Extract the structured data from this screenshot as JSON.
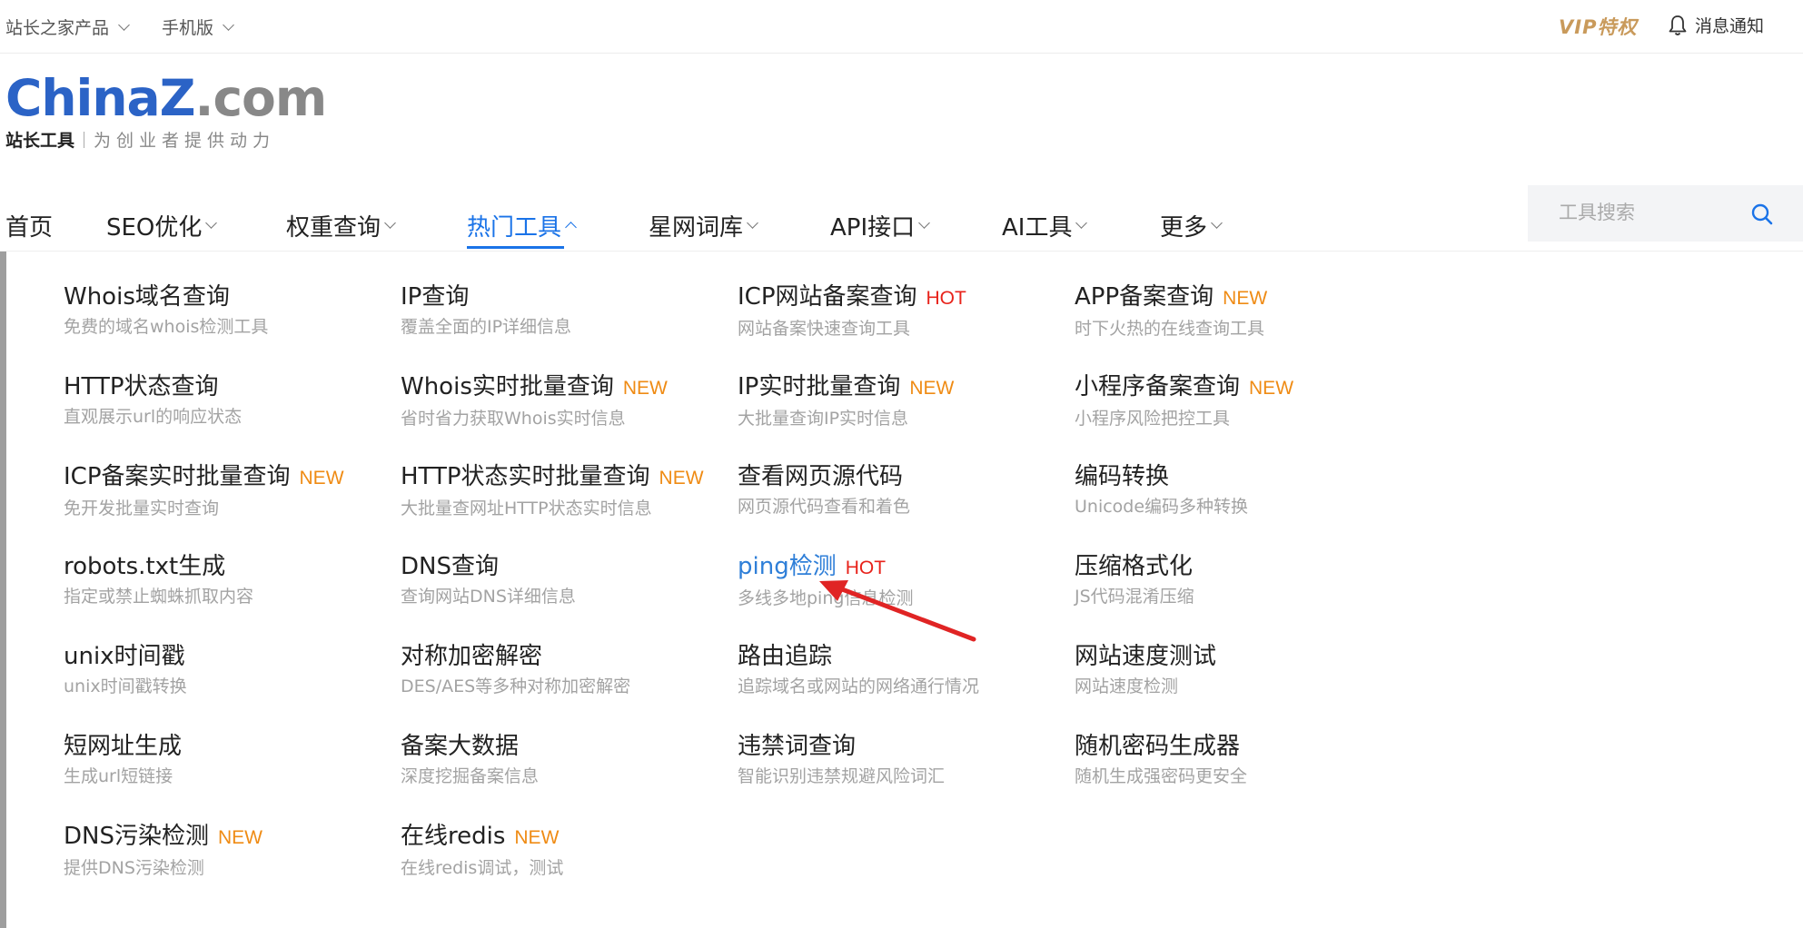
{
  "topbar": {
    "products": "站长之家产品",
    "mobile": "手机版",
    "vip": "VIP特权",
    "notice": "消息通知"
  },
  "logo": {
    "china": "China",
    "z": "Z",
    "com": ".com",
    "sub_bold": "站长工具",
    "slogan": "为创业者提供动力"
  },
  "nav": {
    "items": [
      {
        "label": "首页"
      },
      {
        "label": "SEO优化"
      },
      {
        "label": "权重查询"
      },
      {
        "label": "热门工具"
      },
      {
        "label": "星网词库"
      },
      {
        "label": "API接口"
      },
      {
        "label": "AI工具"
      },
      {
        "label": "更多"
      }
    ],
    "active": "热门工具",
    "search_placeholder": "工具搜索"
  },
  "tools": [
    [
      {
        "name": "Whois域名查询",
        "desc": "免费的域名whois检测工具",
        "badge": ""
      },
      {
        "name": "HTTP状态查询",
        "desc": "直观展示url的响应状态",
        "badge": ""
      },
      {
        "name": "ICP备案实时批量查询",
        "desc": "免开发批量实时查询",
        "badge": "NEW"
      },
      {
        "name": "robots.txt生成",
        "desc": "指定或禁止蜘蛛抓取内容",
        "badge": ""
      },
      {
        "name": "unix时间戳",
        "desc": "unix时间戳转换",
        "badge": ""
      },
      {
        "name": "短网址生成",
        "desc": "生成url短链接",
        "badge": ""
      },
      {
        "name": "DNS污染检测",
        "desc": "提供DNS污染检测",
        "badge": "NEW"
      }
    ],
    [
      {
        "name": "IP查询",
        "desc": "覆盖全面的IP详细信息",
        "badge": ""
      },
      {
        "name": "Whois实时批量查询",
        "desc": "省时省力获取Whois实时信息",
        "badge": "NEW"
      },
      {
        "name": "HTTP状态实时批量查询",
        "desc": "大批量查网址HTTP状态实时信息",
        "badge": "NEW"
      },
      {
        "name": "DNS查询",
        "desc": "查询网站DNS详细信息",
        "badge": ""
      },
      {
        "name": "对称加密解密",
        "desc": "DES/AES等多种对称加密解密",
        "badge": ""
      },
      {
        "name": "备案大数据",
        "desc": "深度挖掘备案信息",
        "badge": ""
      },
      {
        "name": "在线redis",
        "desc": "在线redis调试，测试",
        "badge": "NEW"
      }
    ],
    [
      {
        "name": "ICP网站备案查询",
        "desc": "网站备案快速查询工具",
        "badge": "HOT"
      },
      {
        "name": "IP实时批量查询",
        "desc": "大批量查询IP实时信息",
        "badge": "NEW"
      },
      {
        "name": "查看网页源代码",
        "desc": "网页源代码查看和着色",
        "badge": ""
      },
      {
        "name": "ping检测",
        "desc": "多线多地ping信息检测",
        "badge": "HOT"
      },
      {
        "name": "路由追踪",
        "desc": "追踪域名或网站的网络通行情况",
        "badge": ""
      },
      {
        "name": "违禁词查询",
        "desc": "智能识别违禁规避风险词汇",
        "badge": ""
      }
    ],
    [
      {
        "name": "APP备案查询",
        "desc": "时下火热的在线查询工具",
        "badge": "NEW"
      },
      {
        "name": "小程序备案查询",
        "desc": "小程序风险把控工具",
        "badge": "NEW"
      },
      {
        "name": "编码转换",
        "desc": "Unicode编码多种转换",
        "badge": ""
      },
      {
        "name": "压缩格式化",
        "desc": "JS代码混淆压缩",
        "badge": ""
      },
      {
        "name": "网站速度测试",
        "desc": "网站速度检测",
        "badge": ""
      },
      {
        "name": "随机密码生成器",
        "desc": "随机生成强密码更安全",
        "badge": ""
      }
    ]
  ],
  "colors": {
    "accent": "#1a73e8",
    "hot": "#e8231b",
    "new": "#ef8b14",
    "arrow": "#e02424",
    "vip": "#c99a5b"
  }
}
